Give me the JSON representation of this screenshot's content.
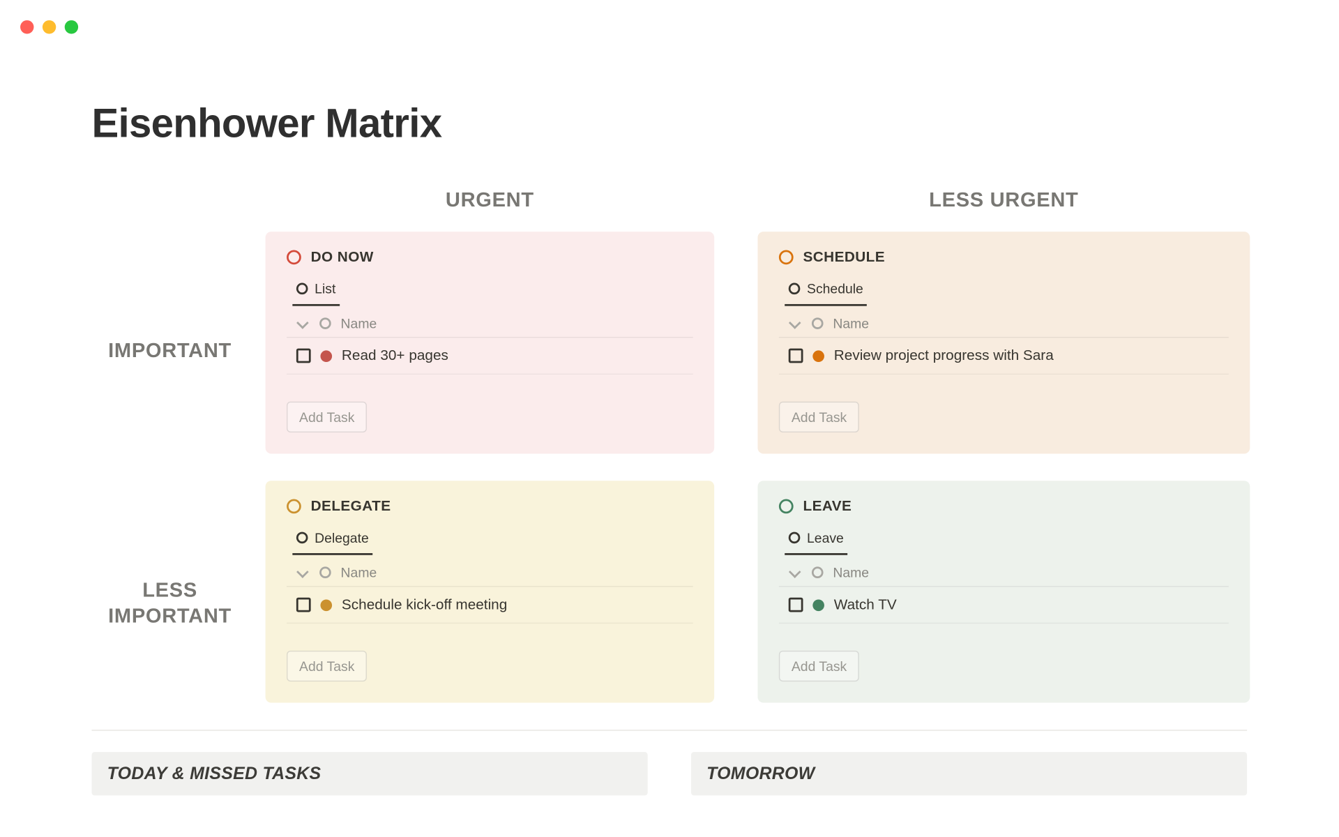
{
  "title": "Eisenhower Matrix",
  "columns": {
    "urgent": "URGENT",
    "less_urgent": "LESS URGENT"
  },
  "rows": {
    "important": "IMPORTANT",
    "less_important": "LESS\nIMPORTANT"
  },
  "quadrants": {
    "do_now": {
      "label": "DO NOW",
      "view": "List",
      "header": "Name",
      "task": "Read 30+ pages",
      "add": "Add Task"
    },
    "schedule": {
      "label": "SCHEDULE",
      "view": "Schedule",
      "header": "Name",
      "task": "Review project progress with Sara",
      "add": "Add Task"
    },
    "delegate": {
      "label": "DELEGATE",
      "view": "Delegate",
      "header": "Name",
      "task": "Schedule kick-off meeting",
      "add": "Add Task"
    },
    "leave": {
      "label": "LEAVE",
      "view": "Leave",
      "header": "Name",
      "task": "Watch TV",
      "add": "Add Task"
    }
  },
  "bottom": {
    "today": "TODAY & MISSED TASKS",
    "tomorrow": "TOMORROW"
  }
}
